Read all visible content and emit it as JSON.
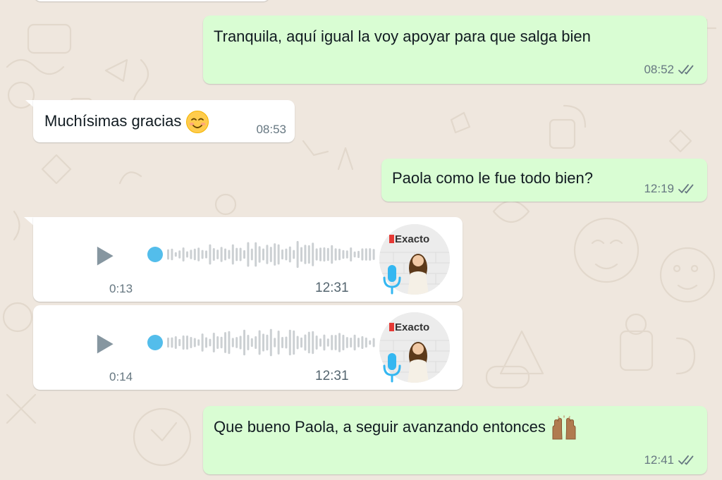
{
  "colors": {
    "outgoing_bubble": "#d9fdd3",
    "incoming_bubble": "#ffffff",
    "background": "#efe7de",
    "read_ticks": "#667781",
    "voice_dot": "#53bdeb",
    "mic": "#34b7f1"
  },
  "messages": [
    {
      "id": "m1",
      "direction": "out",
      "text": "Tranquila, aquí igual la voy apoyar para que salga bien",
      "time": "08:52",
      "status": "double-check-icon"
    },
    {
      "id": "m2",
      "direction": "in",
      "text": "Muchísimas gracias",
      "emoji": "smiling-face-icon",
      "time": "08:53"
    },
    {
      "id": "m3",
      "direction": "out",
      "text": "Paola como le fue todo bien?",
      "time": "12:19",
      "status": "double-check-icon"
    },
    {
      "id": "m4",
      "direction": "in",
      "type": "voice",
      "duration": "0:13",
      "time": "12:31",
      "avatar_label": "Exacto"
    },
    {
      "id": "m5",
      "direction": "in",
      "type": "voice",
      "duration": "0:14",
      "time": "12:31",
      "avatar_label": "Exacto"
    },
    {
      "id": "m6",
      "direction": "out",
      "text": "Que bueno Paola, a seguir avanzando entonces",
      "emoji": "raising-hands-icon",
      "time": "12:41",
      "status": "double-check-icon"
    }
  ]
}
